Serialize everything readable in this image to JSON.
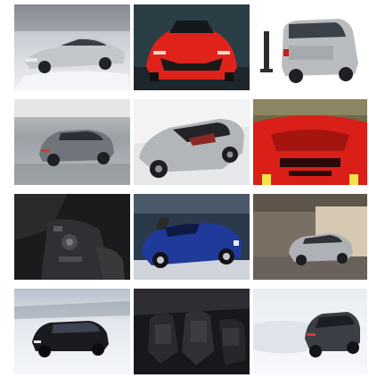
{
  "gallery": {
    "tiles": [
      {
        "id": "t1",
        "icon": "silver-sedan-on-snow-image"
      },
      {
        "id": "t2",
        "icon": "red-sports-car-front-image"
      },
      {
        "id": "t3",
        "icon": "silver-van-with-charger-image"
      },
      {
        "id": "t4",
        "icon": "grey-coupe-wet-track-image"
      },
      {
        "id": "t5",
        "icon": "silver-convertible-image"
      },
      {
        "id": "t6",
        "icon": "red-car-hood-vents-image"
      },
      {
        "id": "t7",
        "icon": "dark-interior-center-console-image"
      },
      {
        "id": "t8",
        "icon": "blue-roadster-image"
      },
      {
        "id": "t9",
        "icon": "silver-suv-garage-image"
      },
      {
        "id": "t10",
        "icon": "black-hatchback-snow-image"
      },
      {
        "id": "t11",
        "icon": "dark-interior-seats-image"
      },
      {
        "id": "t12",
        "icon": "dark-suv-drifting-snow-image"
      }
    ]
  },
  "colors": {
    "background": "#ffffff",
    "snow": "#eef1f5",
    "red_car": "#e0231a",
    "blue_car": "#1f3a9a",
    "silver": "#b9bcc0",
    "dark_interior": "#1b1b1d"
  }
}
